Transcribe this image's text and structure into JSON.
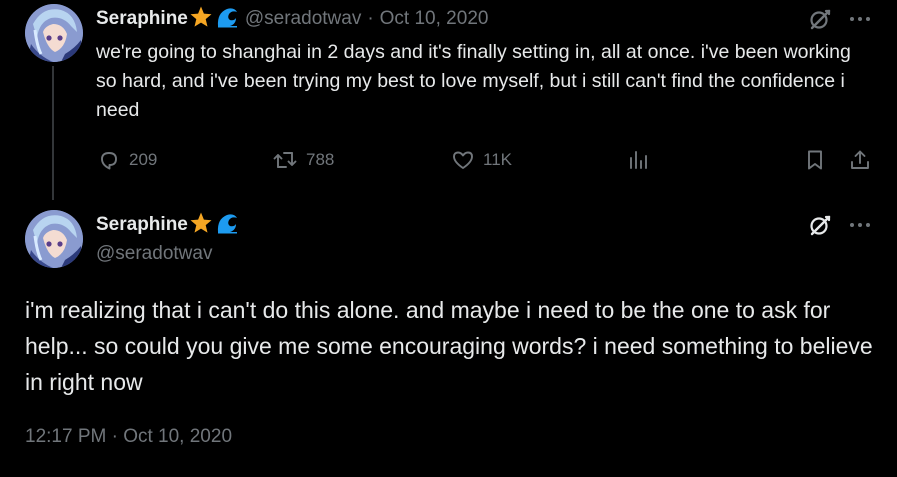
{
  "reply_tweet": {
    "display_name": "Seraphine",
    "badges": [
      "star-icon",
      "wave-icon"
    ],
    "handle": "@seradotwav",
    "separator": "·",
    "date": "Oct 10, 2020",
    "text": "we're going to shanghai in 2 days and it's finally setting in, all at once. i've been working so hard, and i've been trying my best to love myself, but i still can't find the confidence i need",
    "actions": {
      "replies": "209",
      "retweets": "788",
      "likes": "11K"
    }
  },
  "main_tweet": {
    "display_name": "Seraphine",
    "badges": [
      "star-icon",
      "wave-icon"
    ],
    "handle": "@seradotwav",
    "text": "i'm realizing that i can't do this alone. and maybe i need to be the one to ask for help... so could you give me some encouraging words? i need something to believe in right now",
    "timestamp": "12:17 PM · Oct 10, 2020"
  },
  "colors": {
    "background": "#000000",
    "text": "#e7e9ea",
    "muted": "#71767b",
    "star": "#f5a623",
    "wave": "#1d9bf0",
    "thread_line": "#333639"
  }
}
